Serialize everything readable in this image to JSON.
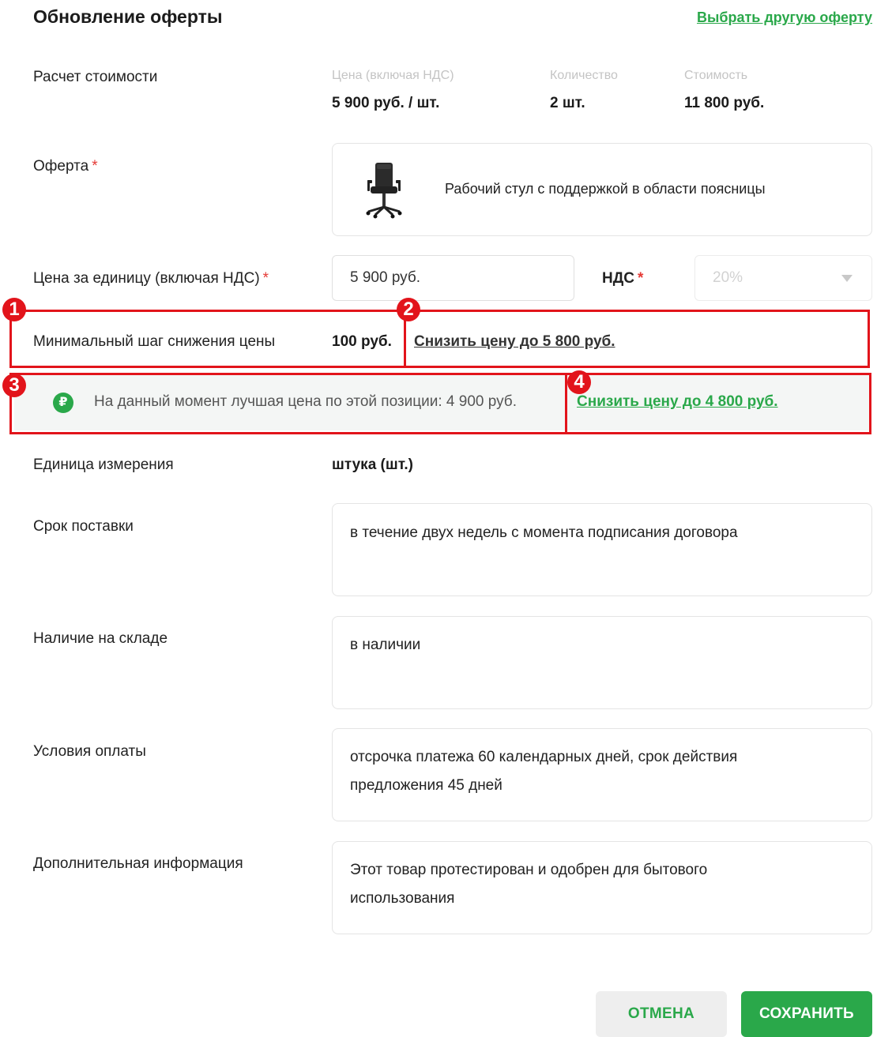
{
  "header": {
    "title": "Обновление оферты",
    "choose_other_link": "Выбрать другую оферту"
  },
  "calc": {
    "label": "Расчет стоимости",
    "columns": [
      {
        "header": "Цена (включая НДС)",
        "value": "5 900 руб. / шт."
      },
      {
        "header": "Количество",
        "value": "2 шт."
      },
      {
        "header": "Стоимость",
        "value": "11 800 руб."
      }
    ]
  },
  "offer": {
    "label": "Оферта",
    "required_mark": "*",
    "product_name": "Рабочий стул с поддержкой в области поясницы",
    "product_icon": "office-chair-icon"
  },
  "unit_price": {
    "label": "Цена за единицу (включая НДС)",
    "required_mark": "*",
    "value": "5 900 руб."
  },
  "vat": {
    "label": "НДС",
    "required_mark": "*",
    "value": "20%"
  },
  "min_step": {
    "label": "Минимальный шаг снижения цены",
    "value": "100 руб.",
    "reduce_link": "Снизить цену до 5 800 руб."
  },
  "best_price": {
    "text": "На данный момент лучшая цена по этой позиции: 4 900 руб.",
    "coin_symbol": "₽",
    "reduce_link": "Снизить цену до 4 800 руб."
  },
  "annotations": [
    "1",
    "2",
    "3",
    "4"
  ],
  "unit": {
    "label": "Единица измерения",
    "value": "штука (шт.)"
  },
  "delivery": {
    "label": "Срок поставки",
    "value": "в течение двух недель с момента подписания договора"
  },
  "stock": {
    "label": "Наличие на складе",
    "value": "в наличии"
  },
  "payment": {
    "label": "Условия оплаты",
    "line1": "отсрочка платежа 60 календарных дней, срок действия",
    "line2": "предложения 45 дней"
  },
  "additional": {
    "label": "Дополнительная информация",
    "line1": "Этот товар протестирован и одобрен для бытового",
    "line2": "использования"
  },
  "buttons": {
    "cancel": "ОТМЕНА",
    "save": "СОХРАНИТЬ"
  },
  "colors": {
    "accent": "#2aa84a",
    "annotation_red": "#e2141b",
    "required_red": "#e53935"
  }
}
